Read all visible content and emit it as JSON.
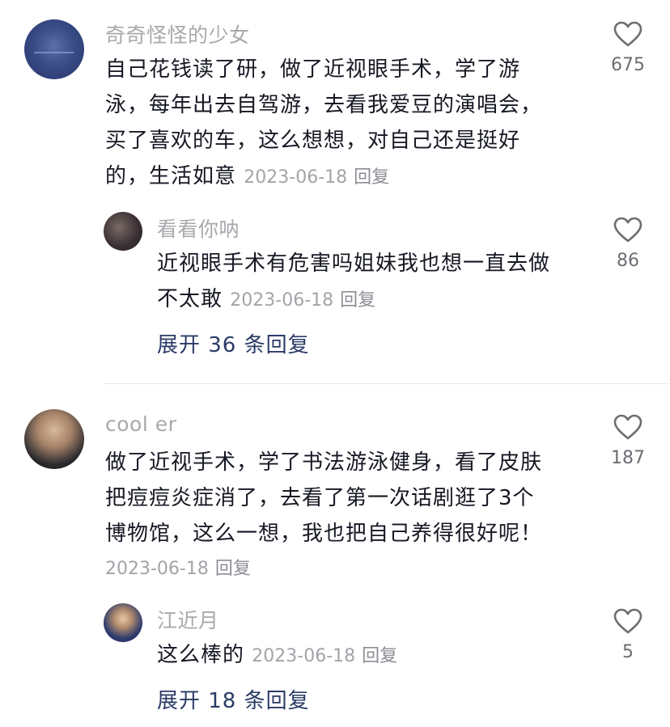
{
  "comments": [
    {
      "username": "奇奇怪怪的少女",
      "avatar_icon": "user-avatar-blue-sky",
      "lines": [
        "自己花钱读了研，做了近视眼手术，学了游",
        "泳，每年出去自驾游，去看我爱豆的演唱会，",
        "买了喜欢的车，这么想想，对自己还是挺好",
        "的，生活如意"
      ],
      "date": "2023-06-18",
      "reply_label": "回复",
      "likes": "675",
      "replies": [
        {
          "username": "看看你呐",
          "avatar_icon": "user-avatar-dark-photo",
          "lines": [
            "近视眼手术有危害吗姐妹我也想一直去做",
            "不太敢"
          ],
          "date": "2023-06-18",
          "reply_label": "回复",
          "likes": "86"
        }
      ],
      "expand_label": "展开 36 条回复"
    },
    {
      "username": "cool er",
      "avatar_icon": "user-avatar-surprised-face",
      "lines": [
        "做了近视手术，学了书法游泳健身，看了皮肤",
        "把痘痘炎症消了，去看了第一次话剧逛了3个",
        "博物馆，这么一想，我也把自己养得很好呢！"
      ],
      "date": "2023-06-18",
      "reply_label": "回复",
      "likes": "187",
      "replies": [
        {
          "username": "江近月",
          "avatar_icon": "user-avatar-selfie",
          "lines": [
            "这么棒的"
          ],
          "date": "2023-06-18",
          "reply_label": "回复",
          "likes": "5"
        }
      ],
      "expand_label": "展开 18 条回复"
    }
  ],
  "icons": {
    "like": "heart-outline-icon"
  },
  "colors": {
    "text": "#161823",
    "username": "#a8a9ad",
    "meta": "#a3a4a9",
    "expand": "#2a3b66"
  }
}
